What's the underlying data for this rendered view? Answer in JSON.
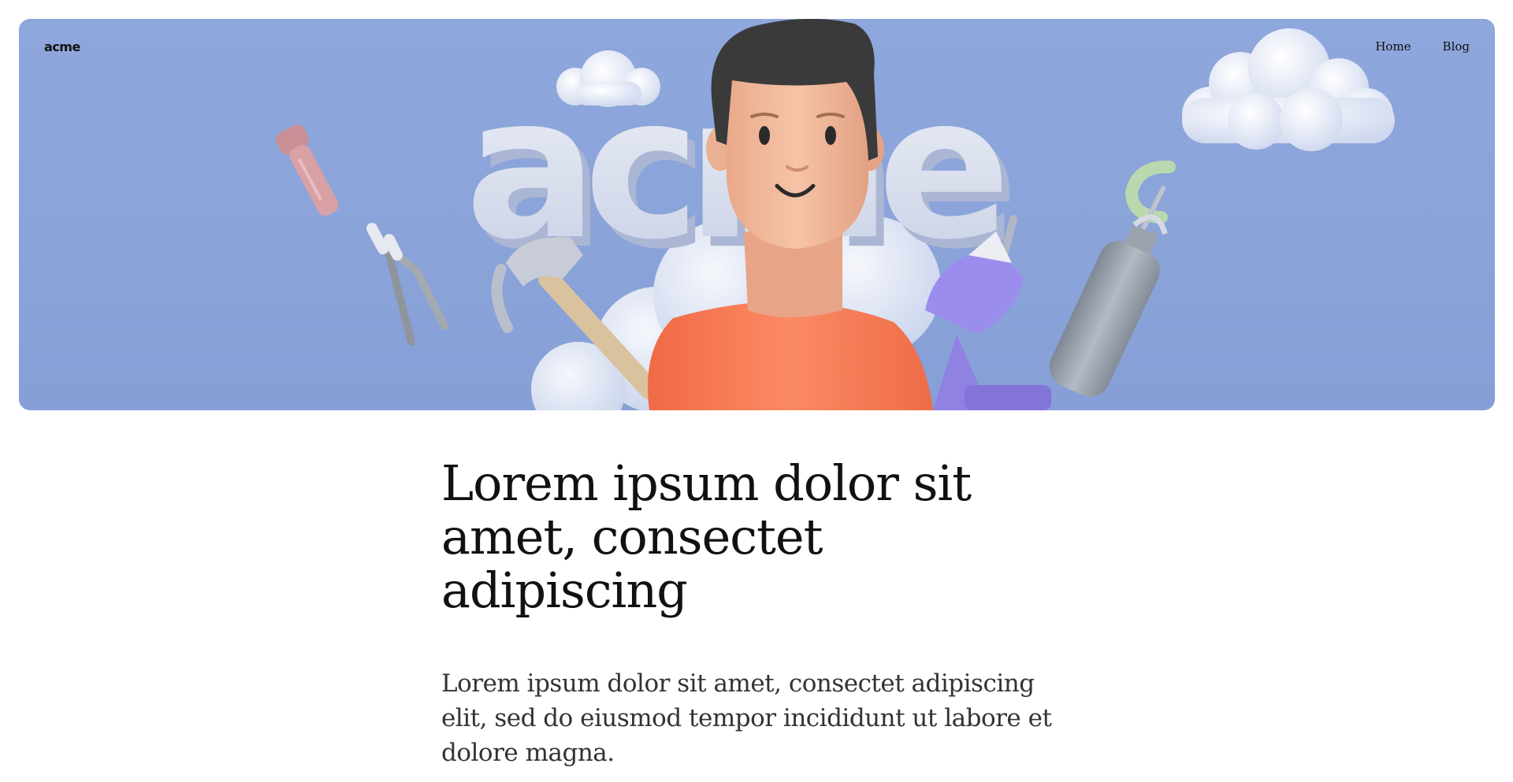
{
  "header": {
    "logo": "acme",
    "nav": [
      {
        "label": "Home"
      },
      {
        "label": "Blog"
      }
    ]
  },
  "hero": {
    "image_text": "acme",
    "background_color": "#8ea7dc",
    "shirt_color": "#f27a55",
    "drill_color": "#9b8ef0"
  },
  "main": {
    "title": "Lorem ipsum dolor sit amet, consectet adipiscing",
    "lead": "Lorem ipsum dolor sit amet, consectet adipiscing elit, sed do eiusmod tempor incididunt ut labore et dolore magna."
  }
}
